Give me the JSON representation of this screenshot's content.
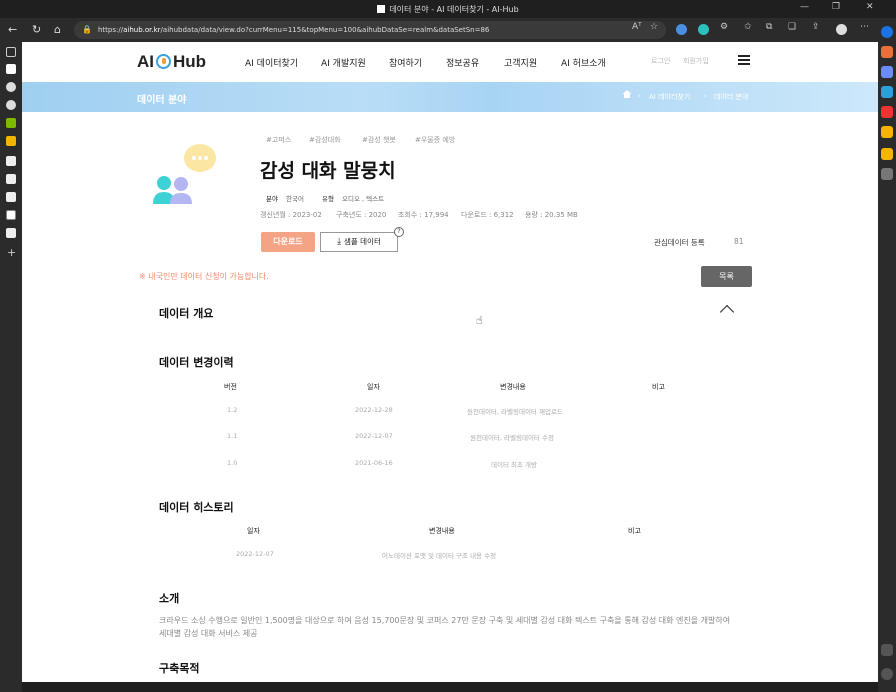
{
  "browser": {
    "tab_title": "데이터 분야 - AI 데이터찾기 - AI-Hub",
    "url_prefix": "https://",
    "url_host": "aihub.or.kr",
    "url_path": "/aihubdata/data/view.do?currMenu=115&topMenu=100&aihubDataSe=realm&dataSetSn=86",
    "read_aloud": "Aᵀ"
  },
  "header": {
    "logo_left": "AI",
    "logo_right": "Hub",
    "menu": [
      "AI 데이터찾기",
      "AI 개발지원",
      "참여하기",
      "정보공유",
      "고객지원",
      "AI 허브소개"
    ],
    "login": "로그인",
    "signup": "회원가입"
  },
  "banner": {
    "title": "데이터 분야",
    "crumb1": "AI 데이터찾기",
    "crumb2": "데이터 분야"
  },
  "dataset": {
    "tags": [
      "#고퍼스",
      "#감성대화",
      "#감성 챗봇",
      "#우울증 예방"
    ],
    "title": "감성 대화 말뭉치",
    "field_label": "분야",
    "field_value": "한국어",
    "type_label": "유형",
    "type_value": "오디오 , 텍스트",
    "stat_update": "갱신년월 : 2023-02",
    "stat_year": "구축년도 : 2020",
    "stat_views": "조회수 : 17,994",
    "stat_downloads": "다운로드 : 6,312",
    "stat_size": "용량 : 20.35 MB",
    "download_btn": "다운로드",
    "sample_btn": "샘플 데이터",
    "help": "?",
    "fav_label": "관심데이터 등록",
    "fav_count": "81"
  },
  "notice": "※ 내국인만 데이터 신청이 가능합니다.",
  "list_btn": "목록",
  "sections": {
    "overview": "데이터 개요",
    "changes": "데이터 변경이력",
    "history": "데이터 히스토리",
    "intro": "소개",
    "purpose": "구축목적"
  },
  "changes_table": {
    "headers": [
      "버전",
      "일자",
      "변경내용",
      "비고"
    ],
    "rows": [
      [
        "1.2",
        "2022-12-28",
        "원천데이터, 라벨링데이터 재업로드",
        ""
      ],
      [
        "1.1",
        "2022-12-07",
        "원천데이터, 라벨링데이터 수정",
        ""
      ],
      [
        "1.0",
        "2021-06-16",
        "데이터 최초 개방",
        ""
      ]
    ]
  },
  "history_table": {
    "headers": [
      "일자",
      "변경내용",
      "비고"
    ],
    "rows": [
      [
        "2022-12-07",
        "어노테이션 포맷 및 데이터 구조 내용 수정",
        ""
      ]
    ]
  },
  "intro_text": "크라우드 소싱 수행으로 일반인 1,500명을 대상으로 하여 음성 15,700문장 및 코퍼스 27만 문장 구축 및 세대별 감성 대화 텍스트 구축을 통해 감성 대화 엔진을 개발하여 세대별 감성 대화 서비스 제공",
  "colors": {
    "accent_download": "#f4a385",
    "notice": "#f08a6a",
    "banner": "#a8d4f4"
  }
}
